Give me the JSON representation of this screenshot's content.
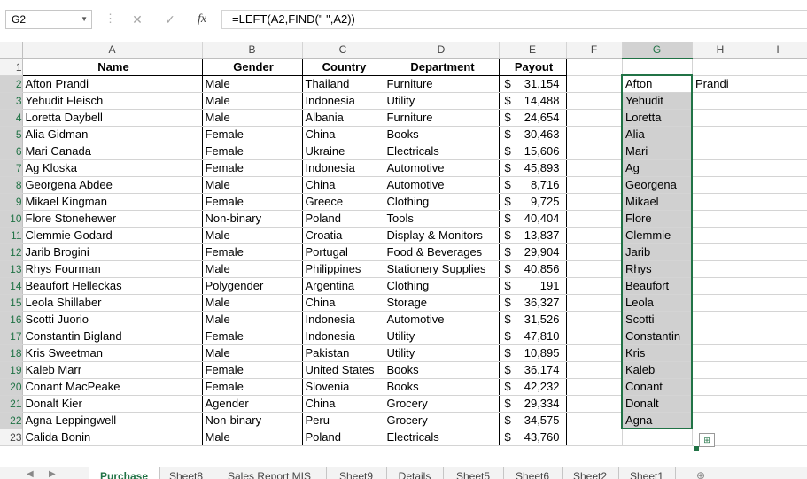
{
  "formula_bar": {
    "name_box": "G2",
    "formula": "=LEFT(A2,FIND(\" \",A2))",
    "cancel_icon": "✕",
    "enter_icon": "✓",
    "fx_icon": "fx"
  },
  "columns": [
    "A",
    "B",
    "C",
    "D",
    "E",
    "F",
    "G",
    "H",
    "I"
  ],
  "header_row": {
    "row": "1",
    "name": "Name",
    "gender": "Gender",
    "country": "Country",
    "department": "Department",
    "payout": "Payout"
  },
  "rows": [
    {
      "row": "2",
      "name": "Afton Prandi",
      "gender": "Male",
      "country": "Thailand",
      "department": "Furniture",
      "cur": "$",
      "payout": "31,154",
      "g": "Afton",
      "h": "Prandi"
    },
    {
      "row": "3",
      "name": "Yehudit Fleisch",
      "gender": "Male",
      "country": "Indonesia",
      "department": "Utility",
      "cur": "$",
      "payout": "14,488",
      "g": "Yehudit",
      "h": ""
    },
    {
      "row": "4",
      "name": "Loretta Daybell",
      "gender": "Male",
      "country": "Albania",
      "department": "Furniture",
      "cur": "$",
      "payout": "24,654",
      "g": "Loretta",
      "h": ""
    },
    {
      "row": "5",
      "name": "Alia Gidman",
      "gender": "Female",
      "country": "China",
      "department": "Books",
      "cur": "$",
      "payout": "30,463",
      "g": "Alia",
      "h": ""
    },
    {
      "row": "6",
      "name": "Mari Canada",
      "gender": "Female",
      "country": "Ukraine",
      "department": "Electricals",
      "cur": "$",
      "payout": "15,606",
      "g": "Mari",
      "h": ""
    },
    {
      "row": "7",
      "name": "Ag Kloska",
      "gender": "Female",
      "country": "Indonesia",
      "department": "Automotive",
      "cur": "$",
      "payout": "45,893",
      "g": "Ag",
      "h": ""
    },
    {
      "row": "8",
      "name": "Georgena Abdee",
      "gender": "Male",
      "country": "China",
      "department": "Automotive",
      "cur": "$",
      "payout": "8,716",
      "g": "Georgena",
      "h": ""
    },
    {
      "row": "9",
      "name": "Mikael Kingman",
      "gender": "Female",
      "country": "Greece",
      "department": "Clothing",
      "cur": "$",
      "payout": "9,725",
      "g": "Mikael",
      "h": ""
    },
    {
      "row": "10",
      "name": "Flore Stonehewer",
      "gender": "Non-binary",
      "country": "Poland",
      "department": "Tools",
      "cur": "$",
      "payout": "40,404",
      "g": "Flore",
      "h": ""
    },
    {
      "row": "11",
      "name": "Clemmie Godard",
      "gender": "Male",
      "country": "Croatia",
      "department": "Display & Monitors",
      "cur": "$",
      "payout": "13,837",
      "g": "Clemmie",
      "h": ""
    },
    {
      "row": "12",
      "name": "Jarib Brogini",
      "gender": "Female",
      "country": "Portugal",
      "department": "Food & Beverages",
      "cur": "$",
      "payout": "29,904",
      "g": "Jarib",
      "h": ""
    },
    {
      "row": "13",
      "name": "Rhys Fourman",
      "gender": "Male",
      "country": "Philippines",
      "department": "Stationery Supplies",
      "cur": "$",
      "payout": "40,856",
      "g": "Rhys",
      "h": ""
    },
    {
      "row": "14",
      "name": "Beaufort Helleckas",
      "gender": "Polygender",
      "country": "Argentina",
      "department": "Clothing",
      "cur": "$",
      "payout": "191",
      "g": "Beaufort",
      "h": ""
    },
    {
      "row": "15",
      "name": "Leola Shillaber",
      "gender": "Male",
      "country": "China",
      "department": "Storage",
      "cur": "$",
      "payout": "36,327",
      "g": "Leola",
      "h": ""
    },
    {
      "row": "16",
      "name": "Scotti Juorio",
      "gender": "Male",
      "country": "Indonesia",
      "department": "Automotive",
      "cur": "$",
      "payout": "31,526",
      "g": "Scotti",
      "h": ""
    },
    {
      "row": "17",
      "name": "Constantin Bigland",
      "gender": "Female",
      "country": "Indonesia",
      "department": "Utility",
      "cur": "$",
      "payout": "47,810",
      "g": "Constantin",
      "h": ""
    },
    {
      "row": "18",
      "name": "Kris Sweetman",
      "gender": "Male",
      "country": "Pakistan",
      "department": "Utility",
      "cur": "$",
      "payout": "10,895",
      "g": "Kris",
      "h": ""
    },
    {
      "row": "19",
      "name": "Kaleb Marr",
      "gender": "Female",
      "country": "United States",
      "department": "Books",
      "cur": "$",
      "payout": "36,174",
      "g": "Kaleb",
      "h": ""
    },
    {
      "row": "20",
      "name": "Conant MacPeake",
      "gender": "Female",
      "country": "Slovenia",
      "department": "Books",
      "cur": "$",
      "payout": "42,232",
      "g": "Conant",
      "h": ""
    },
    {
      "row": "21",
      "name": "Donalt Kier",
      "gender": "Agender",
      "country": "China",
      "department": "Grocery",
      "cur": "$",
      "payout": "29,334",
      "g": "Donalt",
      "h": ""
    },
    {
      "row": "22",
      "name": "Agna Leppingwell",
      "gender": "Non-binary",
      "country": "Peru",
      "department": "Grocery",
      "cur": "$",
      "payout": "34,575",
      "g": "Agna",
      "h": ""
    },
    {
      "row": "23",
      "name": "Calida Bonin",
      "gender": "Male",
      "country": "Poland",
      "department": "Electricals",
      "cur": "$",
      "payout": "43,760",
      "g": "",
      "h": ""
    }
  ],
  "sheet_tabs": [
    "Purchase",
    "Sheet8",
    "Sales Report MIS",
    "Sheet9",
    "Details",
    "Sheet5",
    "Sheet6",
    "Sheet2",
    "Sheet1"
  ],
  "active_tab": "Purchase",
  "colors": {
    "accent": "#217346",
    "selection_fill": "#d0d0d0"
  }
}
